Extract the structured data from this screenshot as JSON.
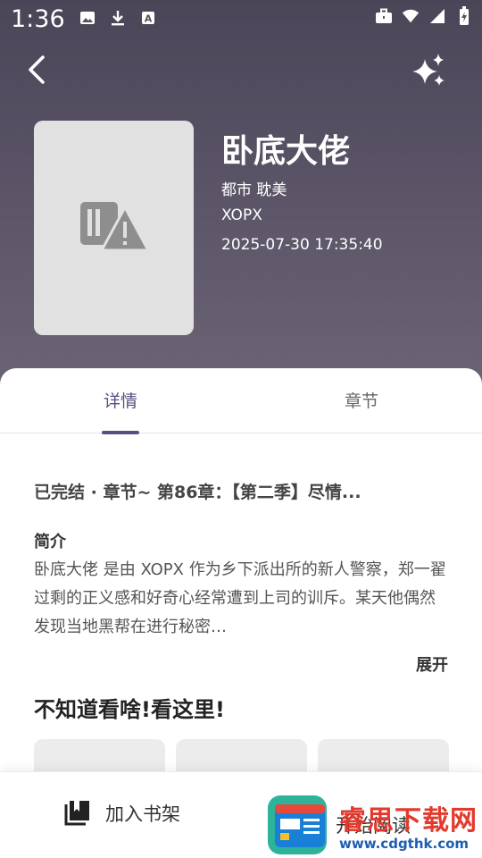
{
  "status_bar": {
    "time": "1:36",
    "left_icons": [
      "image-icon",
      "download-icon",
      "text-a-icon"
    ],
    "right_icons": [
      "briefcase-icon",
      "wifi-icon",
      "signal-icon",
      "battery-icon"
    ]
  },
  "header": {
    "back_icon": "back-arrow-icon",
    "action_icon": "sparkle-icon"
  },
  "book": {
    "title": "卧底大佬",
    "tags": "都市 耽美",
    "author": "XOPX",
    "updated": "2025-07-30 17:35:40",
    "cover_icon": "broken-image-icon"
  },
  "tabs": [
    {
      "label": "详情",
      "active": true
    },
    {
      "label": "章节",
      "active": false
    }
  ],
  "details": {
    "status_line": "已完结 · 章节~ 第86章：【第二季】尽情...",
    "intro_title": "简介",
    "intro_text": "卧底大佬 是由 XOPX 作为乡下派出所的新人警察，郑一翟过剩的正义感和好奇心经常遭到上司的训斥。某天他偶然发现当地黑帮在进行秘密…",
    "expand_label": "展开",
    "recommend_title": "不知道看啥!看这里!"
  },
  "bottom_bar": {
    "shelf_label": "加入书架",
    "read_label": "开始阅读"
  },
  "watermark": {
    "top": "睿思下载网",
    "bottom": "www.cdgthk.com"
  },
  "colors": {
    "hero": "#574f62",
    "accent": "#5b4d80",
    "watermark_red": "#e33a2d",
    "watermark_blue": "#1e5db3"
  }
}
